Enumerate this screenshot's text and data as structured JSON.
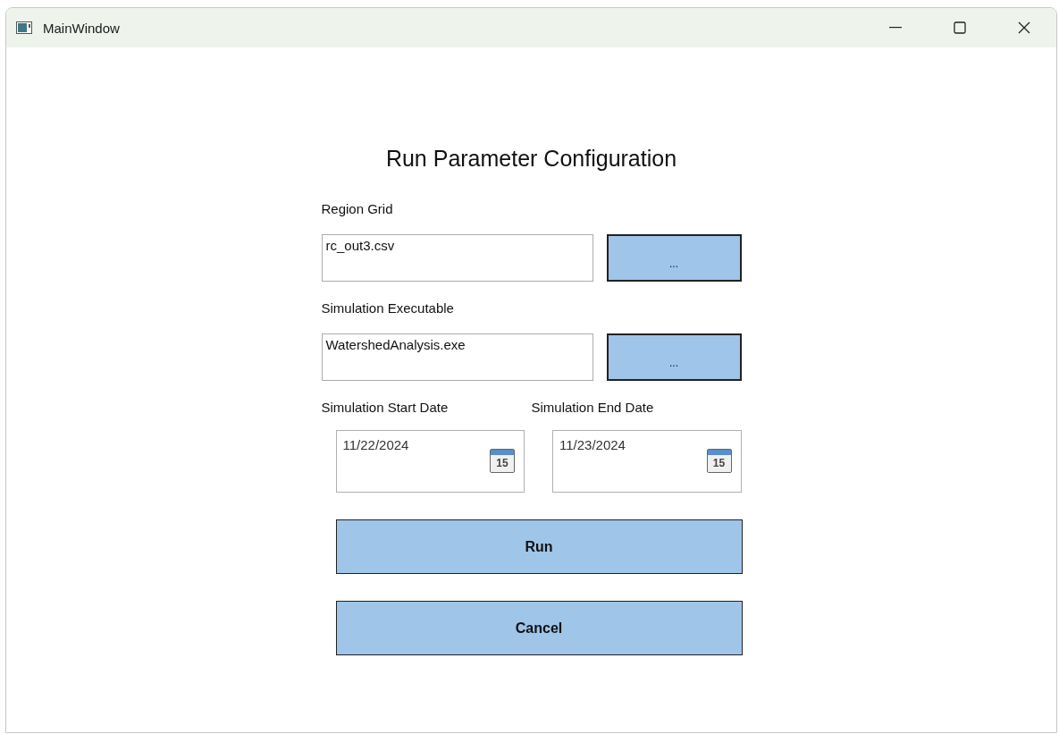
{
  "window": {
    "title": "MainWindow"
  },
  "heading": "Run Parameter Configuration",
  "file_rows": [
    {
      "label": "Region Grid",
      "value": "rc_out3.csv",
      "button": "..."
    },
    {
      "label": "Simulation Executable",
      "value": "WatershedAnalysis.exe",
      "button": "..."
    }
  ],
  "dates": [
    {
      "label": "Simulation Start Date",
      "value": "11/22/2024",
      "calendar_day": "15"
    },
    {
      "label": "Simulation End Date",
      "value": "11/23/2024",
      "calendar_day": "15"
    }
  ],
  "buttons": [
    "Run",
    "Cancel"
  ]
}
